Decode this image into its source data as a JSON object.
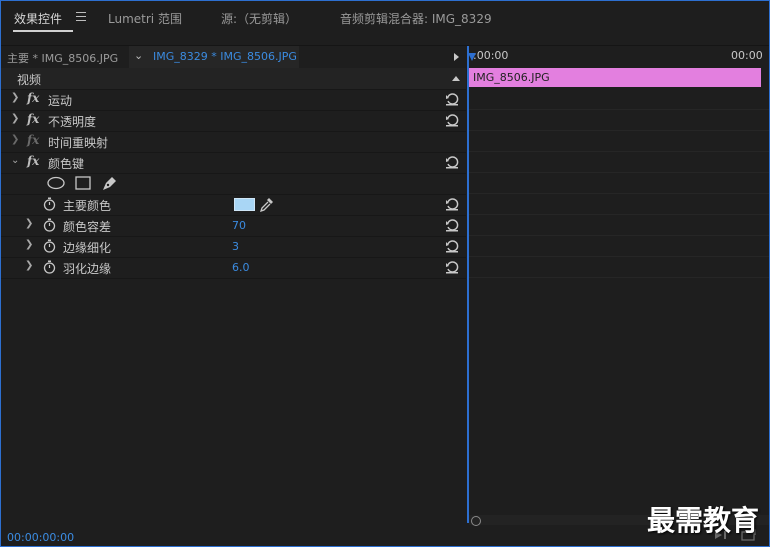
{
  "tabs": [
    {
      "label": "效果控件",
      "active": true
    },
    {
      "label": "Lumetri 范围",
      "active": false
    },
    {
      "label": "源:（无剪辑）",
      "active": false
    },
    {
      "label": "音频剪辑混合器: IMG_8329",
      "active": false
    }
  ],
  "clipbar": {
    "master_label": "主要 * IMG_8506.JPG",
    "sequence_label": "IMG_8329 * IMG_8506.JPG"
  },
  "timeline": {
    "start_time": ":00:00",
    "end_time": "00:00",
    "clip_name": "IMG_8506.JPG",
    "clip_color": "#e37fdf"
  },
  "section": {
    "label": "视频"
  },
  "effects": [
    {
      "label": "运动",
      "enabled": true
    },
    {
      "label": "不透明度",
      "enabled": true
    },
    {
      "label": "时间重映射",
      "enabled": false
    },
    {
      "label": "颜色键",
      "enabled": true,
      "expanded": true
    }
  ],
  "mask_tools": [
    "ellipse-mask-icon",
    "rectangle-mask-icon",
    "pen-mask-icon"
  ],
  "params": [
    {
      "label": "主要颜色",
      "value": "",
      "color": "#a9d6f5"
    },
    {
      "label": "颜色容差",
      "value": "70"
    },
    {
      "label": "边缘细化",
      "value": "3"
    },
    {
      "label": "羽化边缘",
      "value": "6.0"
    }
  ],
  "footer": {
    "timecode": "00:00:00:00"
  },
  "watermark": "最需教育",
  "colors": {
    "accent": "#2d6fd0",
    "value_blue": "#3b8be0"
  }
}
